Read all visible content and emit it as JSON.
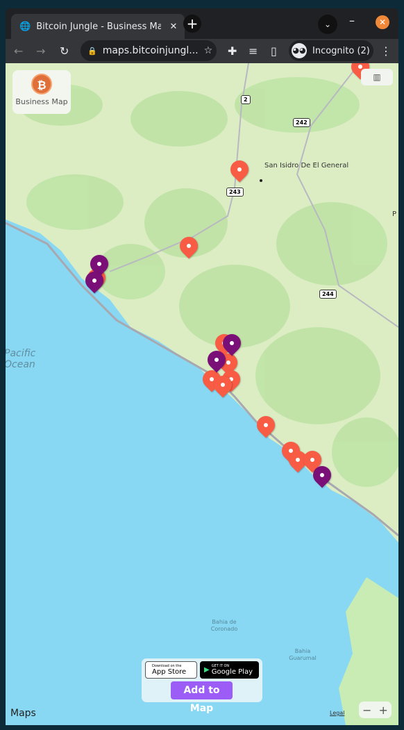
{
  "browser": {
    "tab_title": "Bitcoin Jungle - Business Map",
    "url": "maps.bitcoinjungl...",
    "profile": "Incognito (2)",
    "icons": [
      "globe-icon",
      "close-icon",
      "plus-icon",
      "chevron-down-icon",
      "minimize-icon",
      "back-icon",
      "forward-icon",
      "reload-icon",
      "lock-icon",
      "star-icon",
      "puzzle-icon",
      "media-icon",
      "sidepanel-icon",
      "incognito-icon",
      "more-icon"
    ]
  },
  "map": {
    "logo_label": "Business Map",
    "places": [
      {
        "label": "San Isidro De El General"
      },
      {
        "label": "P"
      }
    ],
    "roads": [
      "2",
      "242",
      "243",
      "244"
    ],
    "water": {
      "ocean": "Pacific Ocean",
      "bay1": "Bahia de Coronado",
      "bay2": "Bahia Guarumal"
    },
    "pin_colors": {
      "orange": "#f95c45",
      "purple": "#7b0f78"
    },
    "attribution": "Maps",
    "legal": "Legal",
    "zoom_out": "−",
    "zoom_in": "+"
  },
  "promo": {
    "app_store_small": "Download on the",
    "app_store": "App Store",
    "google_small": "GET IT ON",
    "google_play": "Google Play",
    "add_to_map": "Add to Map"
  }
}
